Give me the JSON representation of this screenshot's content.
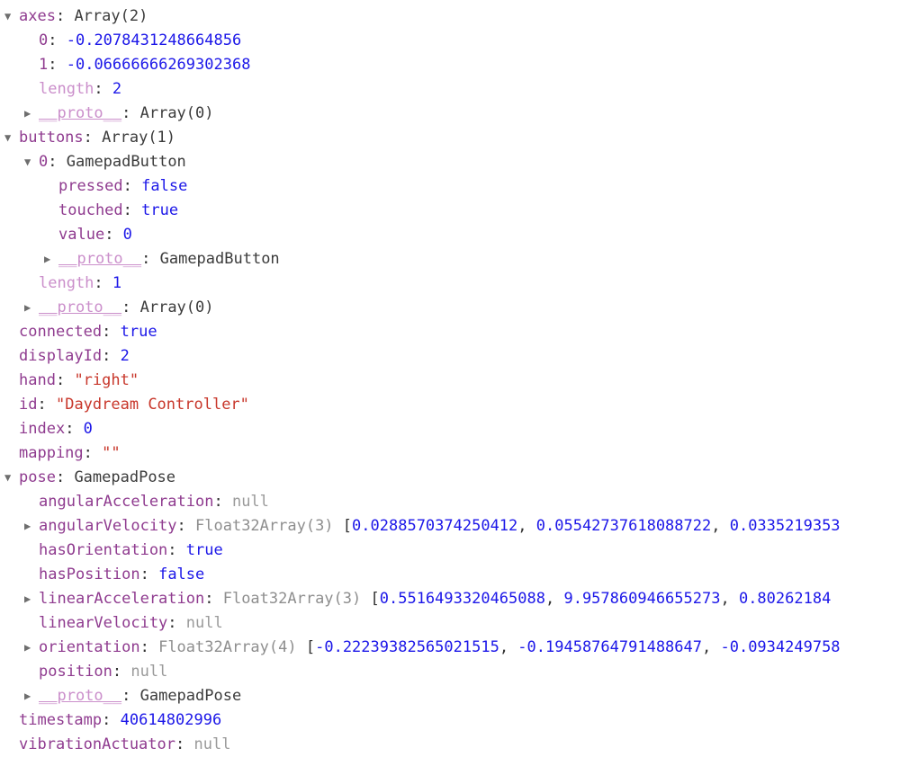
{
  "panel": {
    "name": "devtools-object-inspector",
    "expanded_root": "Gamepad",
    "colors": {
      "background": "#ffffff",
      "property_name": "#8f3b8f",
      "property_name_dim": "#cb8fcb",
      "number": "#1c17e8",
      "boolean": "#1c17e8",
      "string": "#c8372b",
      "null": "#9a9a9a",
      "class_name": "#3b3b3b",
      "type_name": "#8e8e8e",
      "arrow": "#6e6e6e"
    },
    "glyphs": {
      "expanded_arrow": "▼",
      "collapsed_arrow": "▶"
    }
  },
  "rows": [
    {
      "arrow": "expanded",
      "indent": 0,
      "key": "axes",
      "key_style": "key",
      "sep": ": ",
      "value": "Array(2)",
      "value_style": "cls"
    },
    {
      "arrow": "none",
      "indent": 1,
      "key": "0",
      "key_style": "key",
      "sep": ": ",
      "value": "-0.2078431248664856",
      "value_style": "num"
    },
    {
      "arrow": "none",
      "indent": 1,
      "key": "1",
      "key_style": "key",
      "sep": ": ",
      "value": "-0.06666666269302368",
      "value_style": "num"
    },
    {
      "arrow": "none",
      "indent": 1,
      "key": "length",
      "key_style": "key-dim",
      "sep": ": ",
      "value": "2",
      "value_style": "num"
    },
    {
      "arrow": "collapsed",
      "indent": 1,
      "key": "__proto__",
      "key_style": "key-proto",
      "sep": ": ",
      "value": "Array(0)",
      "value_style": "cls"
    },
    {
      "arrow": "expanded",
      "indent": 0,
      "key": "buttons",
      "key_style": "key",
      "sep": ": ",
      "value": "Array(1)",
      "value_style": "cls"
    },
    {
      "arrow": "expanded",
      "indent": 1,
      "key": "0",
      "key_style": "key",
      "sep": ": ",
      "value": "GamepadButton",
      "value_style": "cls"
    },
    {
      "arrow": "none",
      "indent": 2,
      "key": "pressed",
      "key_style": "key",
      "sep": ": ",
      "value": "false",
      "value_style": "bool"
    },
    {
      "arrow": "none",
      "indent": 2,
      "key": "touched",
      "key_style": "key",
      "sep": ": ",
      "value": "true",
      "value_style": "bool"
    },
    {
      "arrow": "none",
      "indent": 2,
      "key": "value",
      "key_style": "key",
      "sep": ": ",
      "value": "0",
      "value_style": "num"
    },
    {
      "arrow": "collapsed",
      "indent": 2,
      "key": "__proto__",
      "key_style": "key-proto",
      "sep": ": ",
      "value": "GamepadButton",
      "value_style": "cls"
    },
    {
      "arrow": "none",
      "indent": 1,
      "key": "length",
      "key_style": "key-dim",
      "sep": ": ",
      "value": "1",
      "value_style": "num"
    },
    {
      "arrow": "collapsed",
      "indent": 1,
      "key": "__proto__",
      "key_style": "key-proto",
      "sep": ": ",
      "value": "Array(0)",
      "value_style": "cls"
    },
    {
      "arrow": "none",
      "indent": 0,
      "key": "connected",
      "key_style": "key",
      "sep": ": ",
      "value": "true",
      "value_style": "bool"
    },
    {
      "arrow": "none",
      "indent": 0,
      "key": "displayId",
      "key_style": "key",
      "sep": ": ",
      "value": "2",
      "value_style": "num"
    },
    {
      "arrow": "none",
      "indent": 0,
      "key": "hand",
      "key_style": "key",
      "sep": ": ",
      "value": "\"right\"",
      "value_style": "str"
    },
    {
      "arrow": "none",
      "indent": 0,
      "key": "id",
      "key_style": "key",
      "sep": ": ",
      "value": "\"Daydream Controller\"",
      "value_style": "str"
    },
    {
      "arrow": "none",
      "indent": 0,
      "key": "index",
      "key_style": "key",
      "sep": ": ",
      "value": "0",
      "value_style": "num"
    },
    {
      "arrow": "none",
      "indent": 0,
      "key": "mapping",
      "key_style": "key",
      "sep": ": ",
      "value": "\"\"",
      "value_style": "str"
    },
    {
      "arrow": "expanded",
      "indent": 0,
      "key": "pose",
      "key_style": "key",
      "sep": ": ",
      "value": "GamepadPose",
      "value_style": "cls"
    },
    {
      "arrow": "none",
      "indent": 1,
      "key": "angularAcceleration",
      "key_style": "key",
      "sep": ": ",
      "value": "null",
      "value_style": "nul"
    },
    {
      "arrow": "collapsed",
      "indent": 1,
      "key": "angularVelocity",
      "key_style": "key",
      "sep": ": ",
      "typename": "Float32Array(3)",
      "array_values": [
        "0.0288570374250412",
        "0.05542737618088722",
        "0.0335219353"
      ]
    },
    {
      "arrow": "none",
      "indent": 1,
      "key": "hasOrientation",
      "key_style": "key",
      "sep": ": ",
      "value": "true",
      "value_style": "bool"
    },
    {
      "arrow": "none",
      "indent": 1,
      "key": "hasPosition",
      "key_style": "key",
      "sep": ": ",
      "value": "false",
      "value_style": "bool"
    },
    {
      "arrow": "collapsed",
      "indent": 1,
      "key": "linearAcceleration",
      "key_style": "key",
      "sep": ": ",
      "typename": "Float32Array(3)",
      "array_values": [
        "0.5516493320465088",
        "9.957860946655273",
        "0.80262184"
      ]
    },
    {
      "arrow": "none",
      "indent": 1,
      "key": "linearVelocity",
      "key_style": "key",
      "sep": ": ",
      "value": "null",
      "value_style": "nul"
    },
    {
      "arrow": "collapsed",
      "indent": 1,
      "key": "orientation",
      "key_style": "key",
      "sep": ": ",
      "typename": "Float32Array(4)",
      "array_values": [
        "-0.22239382565021515",
        "-0.19458764791488647",
        "-0.0934249758"
      ]
    },
    {
      "arrow": "none",
      "indent": 1,
      "key": "position",
      "key_style": "key",
      "sep": ": ",
      "value": "null",
      "value_style": "nul"
    },
    {
      "arrow": "collapsed",
      "indent": 1,
      "key": "__proto__",
      "key_style": "key-proto",
      "sep": ": ",
      "value": "GamepadPose",
      "value_style": "cls"
    },
    {
      "arrow": "none",
      "indent": 0,
      "key": "timestamp",
      "key_style": "key",
      "sep": ": ",
      "value": "40614802996",
      "value_style": "num"
    },
    {
      "arrow": "none",
      "indent": 0,
      "key": "vibrationActuator",
      "key_style": "key",
      "sep": ": ",
      "value": "null",
      "value_style": "nul"
    }
  ]
}
